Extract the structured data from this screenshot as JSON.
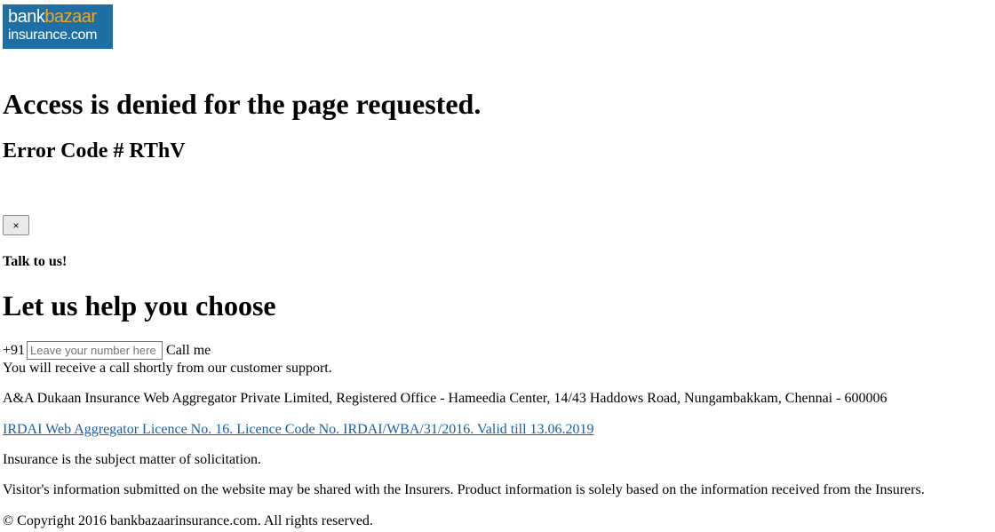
{
  "logo": {
    "line1_a": "bank",
    "line1_b": "bazaar",
    "line2": "insurance.com"
  },
  "error": {
    "heading": "Access is denied for the page requested.",
    "code": "Error Code # RThV"
  },
  "dialog": {
    "close_label": "×",
    "talk_label": "Talk to us!",
    "title": "Let us help you choose",
    "country_code": "+91",
    "phone_placeholder": "Leave your number here",
    "phone_value": "",
    "call_label": "Call me",
    "confirmation": "You will receive a call shortly from our customer support."
  },
  "footer": {
    "address": "A&A Dukaan Insurance Web Aggregator Private Limited, Registered Office - Hameedia Center, 14/43 Haddows Road, Nungambakkam, Chennai - 600006",
    "license_link": "IRDAI Web Aggregator Licence No. 16. Licence Code No. IRDAI/WBA/31/2016. Valid till 13.06.2019",
    "solicitation": "Insurance is the subject matter of solicitation.",
    "disclaimer": "Visitor's information submitted on the website may be shared with the Insurers. Product information is solely based on the information received from the Insurers.",
    "copyright": "© Copyright 2016 bankbazaarinsurance.com. All rights reserved."
  },
  "colors": {
    "logo_bg": "#1e6fa5",
    "logo_accent": "#f5a623",
    "link": "#1a5ea8"
  }
}
